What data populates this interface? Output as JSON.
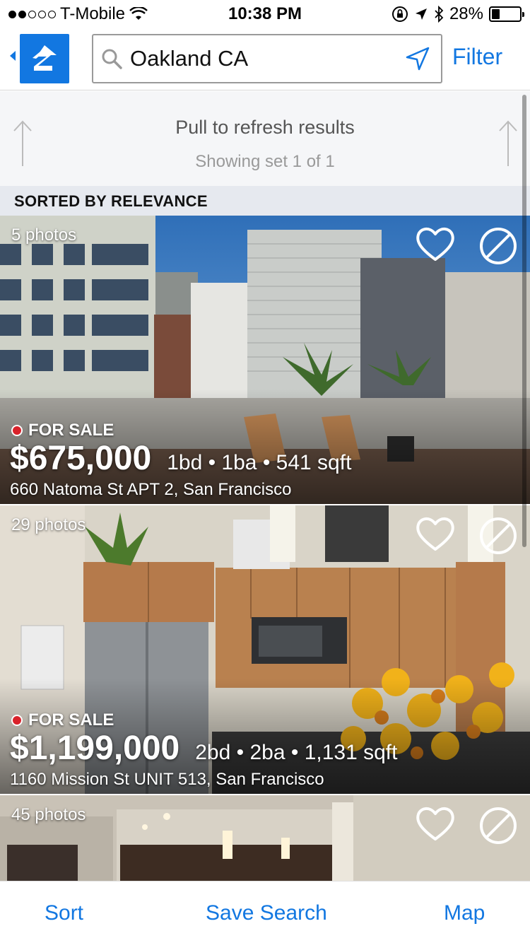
{
  "status_bar": {
    "carrier": "T-Mobile",
    "time": "10:38 PM",
    "battery": "28%",
    "battery_level": 0.28,
    "signal_bars": 2
  },
  "header": {
    "search": {
      "value": "Oakland CA",
      "icon": "search-icon"
    },
    "filter_label": "Filter",
    "brand_color": "#1277e1"
  },
  "refresh": {
    "title": "Pull to refresh results",
    "subtitle": "Showing set 1 of 1"
  },
  "sort_label": "SORTED BY RELEVANCE",
  "listings": [
    {
      "photos": "5 photos",
      "status": "FOR SALE",
      "price": "$675,000",
      "facts": "1bd • 1ba • 541 sqft",
      "address": "660 Natoma St APT 2, San Francisco"
    },
    {
      "photos": "29 photos",
      "status": "FOR SALE",
      "price": "$1,199,000",
      "facts": "2bd • 2ba • 1,131 sqft",
      "address": "1160 Mission St UNIT 513, San Francisco"
    },
    {
      "photos": "45 photos"
    }
  ],
  "bottom_bar": {
    "sort": "Sort",
    "save_search": "Save Search",
    "map": "Map"
  }
}
